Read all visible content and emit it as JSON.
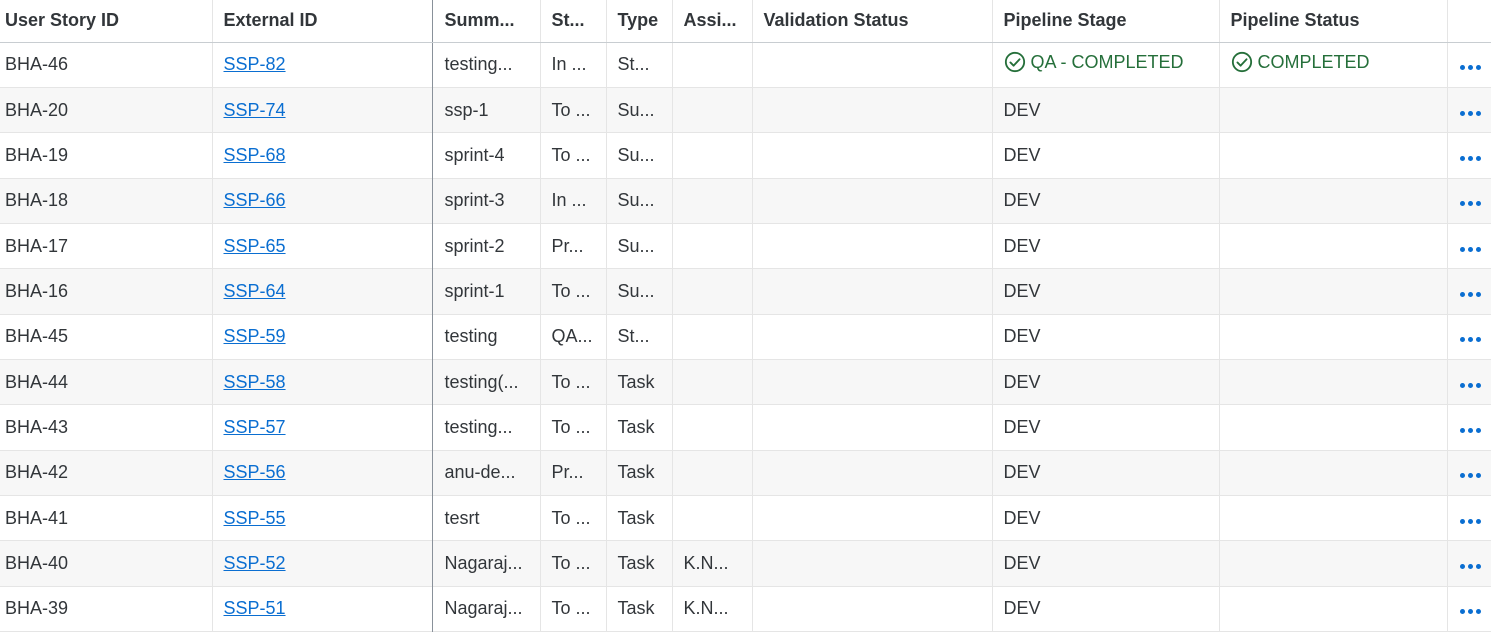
{
  "columns": {
    "user_story_id": "User Story ID",
    "external_id": "External ID",
    "summary": "Summ...",
    "status": "St...",
    "type": "Type",
    "assignee": "Assi...",
    "validation_status": "Validation Status",
    "pipeline_stage": "Pipeline Stage",
    "pipeline_status": "Pipeline Status"
  },
  "colors": {
    "link": "#0a6ed1",
    "success": "#256f3a"
  },
  "rows": [
    {
      "id": "BHA-46",
      "ext": "SSP-82",
      "sum": "testing...",
      "st": "In ...",
      "type": "St...",
      "assi": "",
      "val": "",
      "stage": "QA - COMPLETED",
      "stage_icon": "check-circle-icon",
      "pstat": "COMPLETED",
      "pstat_icon": "check-circle-icon"
    },
    {
      "id": "BHA-20",
      "ext": "SSP-74",
      "sum": "ssp-1",
      "st": "To ...",
      "type": "Su...",
      "assi": "",
      "val": "",
      "stage": "DEV",
      "pstat": ""
    },
    {
      "id": "BHA-19",
      "ext": "SSP-68",
      "sum": "sprint-4",
      "st": "To ...",
      "type": "Su...",
      "assi": "",
      "val": "",
      "stage": "DEV",
      "pstat": ""
    },
    {
      "id": "BHA-18",
      "ext": "SSP-66",
      "sum": "sprint-3",
      "st": "In ...",
      "type": "Su...",
      "assi": "",
      "val": "",
      "stage": "DEV",
      "pstat": ""
    },
    {
      "id": "BHA-17",
      "ext": "SSP-65",
      "sum": "sprint-2",
      "st": "Pr...",
      "type": "Su...",
      "assi": "",
      "val": "",
      "stage": "DEV",
      "pstat": ""
    },
    {
      "id": "BHA-16",
      "ext": "SSP-64",
      "sum": "sprint-1",
      "st": "To ...",
      "type": "Su...",
      "assi": "",
      "val": "",
      "stage": "DEV",
      "pstat": ""
    },
    {
      "id": "BHA-45",
      "ext": "SSP-59",
      "sum": "testing",
      "st": "QA...",
      "type": "St...",
      "assi": "",
      "val": "",
      "stage": "DEV",
      "pstat": ""
    },
    {
      "id": "BHA-44",
      "ext": "SSP-58",
      "sum": "testing(...",
      "st": "To ...",
      "type": "Task",
      "assi": "",
      "val": "",
      "stage": "DEV",
      "pstat": ""
    },
    {
      "id": "BHA-43",
      "ext": "SSP-57",
      "sum": "testing...",
      "st": "To ...",
      "type": "Task",
      "assi": "",
      "val": "",
      "stage": "DEV",
      "pstat": ""
    },
    {
      "id": "BHA-42",
      "ext": "SSP-56",
      "sum": "anu-de...",
      "st": "Pr...",
      "type": "Task",
      "assi": "",
      "val": "",
      "stage": "DEV",
      "pstat": ""
    },
    {
      "id": "BHA-41",
      "ext": "SSP-55",
      "sum": "tesrt",
      "st": "To ...",
      "type": "Task",
      "assi": "",
      "val": "",
      "stage": "DEV",
      "pstat": ""
    },
    {
      "id": "BHA-40",
      "ext": "SSP-52",
      "sum": "Nagaraj...",
      "st": "To ...",
      "type": "Task",
      "assi": "K.N...",
      "val": "",
      "stage": "DEV",
      "pstat": ""
    },
    {
      "id": "BHA-39",
      "ext": "SSP-51",
      "sum": "Nagaraj...",
      "st": "To ...",
      "type": "Task",
      "assi": "K.N...",
      "val": "",
      "stage": "DEV",
      "pstat": ""
    }
  ]
}
